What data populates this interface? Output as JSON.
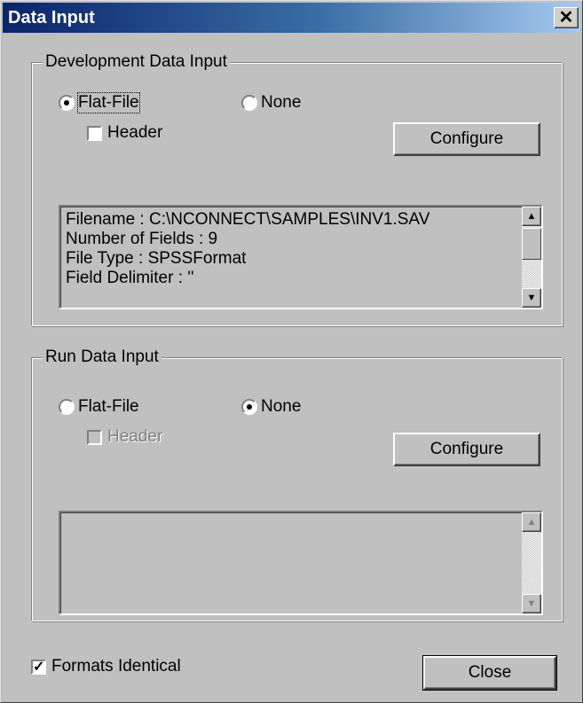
{
  "window": {
    "title": "Data Input",
    "close_glyph": "✕"
  },
  "dev": {
    "group_label": "Development Data Input",
    "radio_flatfile": "Flat-File",
    "radio_none": "None",
    "selected": "Flat-File",
    "header_label": "Header",
    "header_checked": false,
    "configure_label": "Configure",
    "info_lines": [
      "Filename : C:\\NCONNECT\\SAMPLES\\INV1.SAV",
      "Number of Fields : 9",
      "File Type : SPSSFormat",
      "Field Delimiter : ''"
    ]
  },
  "run": {
    "group_label": "Run Data Input",
    "radio_flatfile": "Flat-File",
    "radio_none": "None",
    "selected": "None",
    "header_label": "Header",
    "header_checked": false,
    "configure_label": "Configure"
  },
  "formats_identical": {
    "label": "Formats Identical",
    "checked": true
  },
  "close_button": {
    "label": "Close"
  },
  "icons": {
    "up": "scroll-up-arrow-icon",
    "down": "scroll-down-arrow-icon",
    "check": "check-mark-icon"
  }
}
